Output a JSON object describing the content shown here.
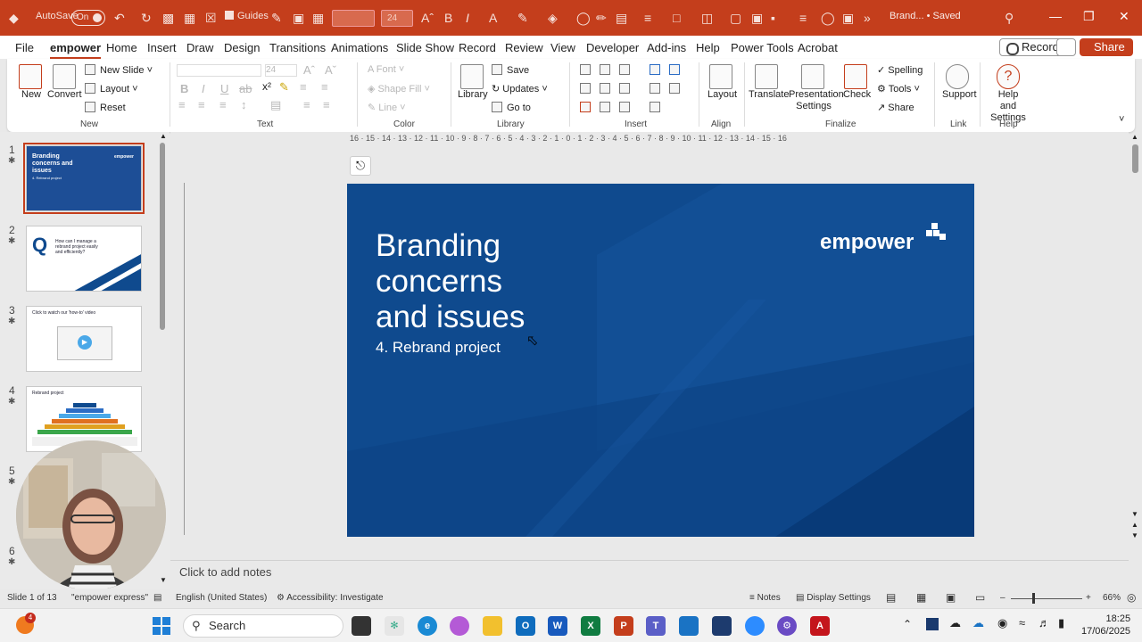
{
  "titlebar": {
    "autosave_label": "AutoSave",
    "autosave_state": "On",
    "guides_label": "Guides",
    "font_size_value": "24",
    "doc_title": "Brand... • Saved"
  },
  "menu": {
    "tabs": [
      "File",
      "empower",
      "Home",
      "Insert",
      "Draw",
      "Design",
      "Transitions",
      "Animations",
      "Slide Show",
      "Record",
      "Review",
      "View",
      "Developer",
      "Add-ins",
      "Help",
      "Power Tools",
      "Acrobat"
    ],
    "record_label": "Record",
    "share_label": "Share"
  },
  "ribbon": {
    "new_label": "New",
    "convert_label": "Convert",
    "new_slide_label": "New Slide",
    "layout_label": "Layout",
    "reset_label": "Reset",
    "group_new": "New",
    "font_size_dim": "24",
    "group_text": "Text",
    "font_label": "Font",
    "shape_fill_label": "Shape Fill",
    "line_label": "Line",
    "group_color": "Color",
    "library_label": "Library",
    "save_label": "Save",
    "updates_label": "Updates",
    "goto_label": "Go to",
    "group_library": "Library",
    "group_insert": "Insert",
    "layout2_label": "Layout",
    "group_align": "Align",
    "translate_label": "Translate",
    "presentation_settings_label": "Presentation Settings",
    "check_label": "Check",
    "spelling_label": "Spelling",
    "tools_label": "Tools",
    "share_label": "Share",
    "group_finalize": "Finalize",
    "support_label": "Support",
    "group_link": "Link",
    "help_settings_label": "Help and Settings",
    "group_help": "Help"
  },
  "thumbnails": [
    {
      "num": "1",
      "title": "Branding concerns and issues",
      "sub": "4. Rebrand project",
      "logo": "empower"
    },
    {
      "num": "2",
      "letter": "Q",
      "text": "How can I manage a rebrand project easily and efficiently?"
    },
    {
      "num": "3",
      "text": "Click to watch our 'how-to' video"
    },
    {
      "num": "4",
      "text": "Rebrand project"
    },
    {
      "num": "5"
    },
    {
      "num": "6"
    }
  ],
  "slide": {
    "title_line1": "Branding",
    "title_line2": "concerns",
    "title_line3": "and issues",
    "subtitle": "4. Rebrand project",
    "logo_text": "empower"
  },
  "ruler": {
    "h_ticks": "16 · 15 · 14 · 13 · 12 · 11 · 10 · 9 · 8 · 7 · 6 · 5 · 4 · 3 · 2 · 1 · 0 · 1 · 2 · 3 · 4 · 5 · 6 · 7 · 8 · 9 · 10 · 11 · 12 · 13 · 14 · 15 · 16"
  },
  "notes_placeholder": "Click to add notes",
  "status": {
    "slide_count": "Slide 1 of 13",
    "template": "\"empower express\"",
    "language": "English (United States)",
    "accessibility": "Accessibility: Investigate",
    "notes": "Notes",
    "display_settings": "Display Settings",
    "zoom": "66%"
  },
  "taskbar": {
    "search_placeholder": "Search",
    "time": "18:25",
    "date": "17/06/2025",
    "badge": "4"
  },
  "colors": {
    "accent": "#c43e1c",
    "slide_blue": "#0f4a8e"
  }
}
